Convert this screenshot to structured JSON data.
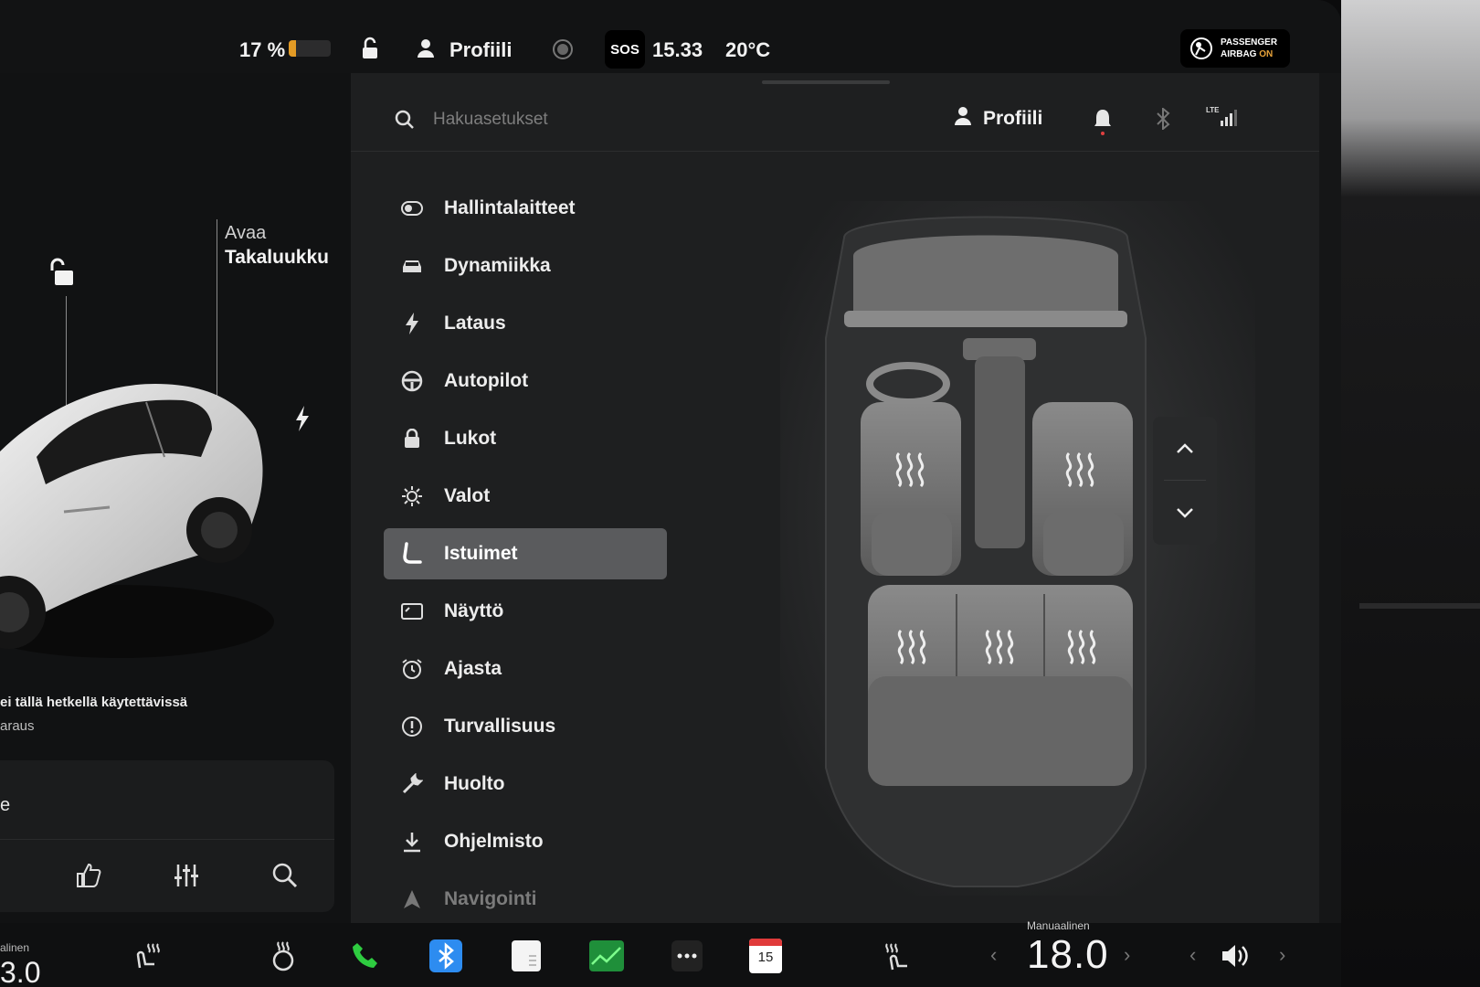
{
  "status_bar": {
    "battery_percent": "17 %",
    "battery_level": 0.17,
    "profile_label": "Profiili",
    "sos_label": "SOS",
    "time": "15.33",
    "temperature": "20°C",
    "airbag_line1": "PASSENGER",
    "airbag_line2": "AIRBAG",
    "airbag_state": "ON"
  },
  "car_panel": {
    "trunk_label_top": "Avaa",
    "trunk_label_bottom": "Takaluukku",
    "notice_line1": "ei tällä hetkellä käytettävissä",
    "notice_line2": "araus",
    "media_text": "e"
  },
  "settings": {
    "search": {
      "placeholder": "Hakuasetukset"
    },
    "profile_label": "Profiili",
    "menu": [
      {
        "label": "Hallintalaitteet",
        "icon": "toggle-icon"
      },
      {
        "label": "Dynamiikka",
        "icon": "car-icon"
      },
      {
        "label": "Lataus",
        "icon": "bolt-icon"
      },
      {
        "label": "Autopilot",
        "icon": "steering-wheel-icon"
      },
      {
        "label": "Lukot",
        "icon": "lock-icon"
      },
      {
        "label": "Valot",
        "icon": "sun-icon"
      },
      {
        "label": "Istuimet",
        "icon": "seat-icon",
        "active": true
      },
      {
        "label": "Näyttö",
        "icon": "display-icon"
      },
      {
        "label": "Ajasta",
        "icon": "alarm-clock-icon"
      },
      {
        "label": "Turvallisuus",
        "icon": "alert-circle-icon"
      },
      {
        "label": "Huolto",
        "icon": "wrench-icon"
      },
      {
        "label": "Ohjelmisto",
        "icon": "download-icon"
      },
      {
        "label": "Navigointi",
        "icon": "navigation-icon"
      }
    ]
  },
  "dock": {
    "left_mode_label": "alinen",
    "left_temp": "3.0",
    "calendar_day": "15",
    "mode_label": "Manuaalinen",
    "temp": "18.0"
  },
  "colors": {
    "accent_battery": "#e39b25",
    "active_menu": "#5a5b5d",
    "phone_green": "#2ecc40",
    "bluetooth_blue": "#2d8cf0"
  }
}
